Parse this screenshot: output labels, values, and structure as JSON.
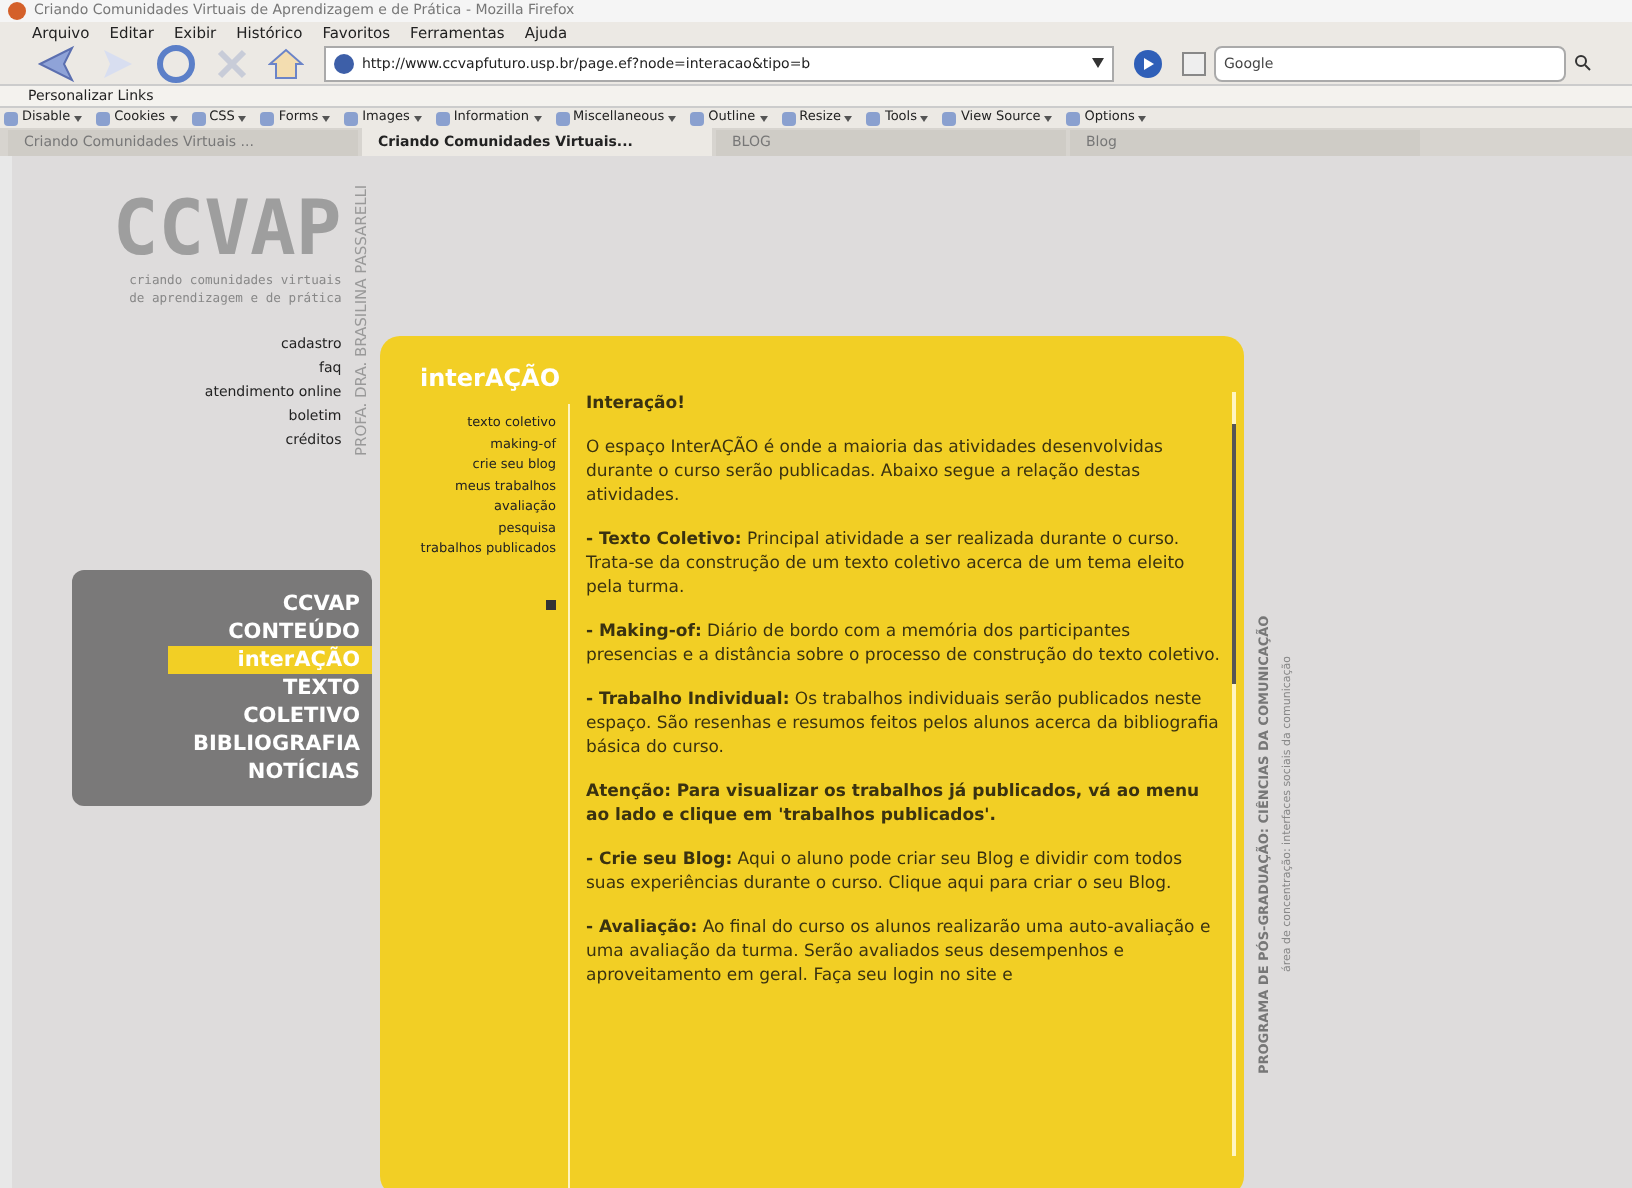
{
  "window": {
    "title": "Criando Comunidades Virtuais de Aprendizagem e de Prática - Mozilla Firefox"
  },
  "menu": [
    "Arquivo",
    "Editar",
    "Exibir",
    "Histórico",
    "Favoritos",
    "Ferramentas",
    "Ajuda"
  ],
  "address": {
    "value": "http://www.ccvapfuturo.usp.br/page.ef?node=interacao&tipo=b"
  },
  "search": {
    "placeholder": "Google"
  },
  "bookmarks": [
    "Personalizar Links"
  ],
  "dev_toolbar": [
    "Disable",
    "Cookies",
    "CSS",
    "Forms",
    "Images",
    "Information",
    "Miscellaneous",
    "Outline",
    "Resize",
    "Tools",
    "View Source",
    "Options"
  ],
  "tabs": [
    {
      "label": "Criando Comunidades Virtuais ...",
      "selected": false
    },
    {
      "label": "Criando Comunidades Virtuais...",
      "selected": true
    },
    {
      "label": "BLOG",
      "selected": false
    },
    {
      "label": "Blog",
      "selected": false
    }
  ],
  "site": {
    "logo": "CCVAP",
    "tagline": [
      "criando comunidades virtuais",
      "de aprendizagem e de prática"
    ],
    "author": "PROFA. DRA. BRASILINA PASSARELLI",
    "links": [
      "cadastro",
      "faq",
      "atendimento online",
      "boletim",
      "créditos"
    ],
    "main_menu": [
      {
        "label": "CCVAP",
        "selected": false
      },
      {
        "label": "CONTEÚDO",
        "selected": false
      },
      {
        "label": "interAÇÃO",
        "selected": true
      },
      {
        "label": "TEXTO COLETIVO",
        "selected": false
      },
      {
        "label": "BIBLIOGRAFIA",
        "selected": false
      },
      {
        "label": "NOTÍCIAS",
        "selected": false
      }
    ],
    "section_title": "interAÇÃO",
    "submenu": [
      "texto coletivo",
      "making-of",
      "crie seu blog",
      "meus trabalhos",
      "avaliação",
      "pesquisa",
      "trabalhos publicados"
    ],
    "content": {
      "heading": "Interação!",
      "paragraphs": [
        "O espaço InterAÇÃO é onde a maioria das atividades desenvolvidas durante o curso serão publicadas. Abaixo segue a relação destas atividades.",
        "**- Texto Coletivo:** Principal atividade a ser realizada durante o curso. Trata-se da construção de um texto coletivo acerca de um tema eleito pela turma.",
        "**- Making-of:** Diário de bordo com a memória dos participantes presencias e a distância sobre o processo de construção do texto coletivo.",
        "**- Trabalho Individual:** Os trabalhos individuais serão publicados neste espaço. São resenhas e resumos feitos pelos alunos acerca da bibliografia básica do curso.",
        "**Atenção: Para visualizar os trabalhos já publicados, vá ao menu ao lado e clique em 'trabalhos publicados'.**",
        "**- Crie seu Blog:** Aqui o aluno pode criar seu Blog e dividir com todos suas experiências durante o curso. Clique aqui para criar o seu Blog.",
        "**- Avaliação:** Ao final do curso os alunos realizarão uma auto-avaliação e uma avaliação da turma. Serão avaliados seus desempenhos e aproveitamento em geral. Faça seu login no site e"
      ]
    },
    "footer": {
      "program": "PROGRAMA DE PÓS-GRADUAÇÃO: CIÊNCIAS DA COMUNICAÇÃO",
      "area": "área de concentração: interfaces sociais da comunicação"
    }
  }
}
